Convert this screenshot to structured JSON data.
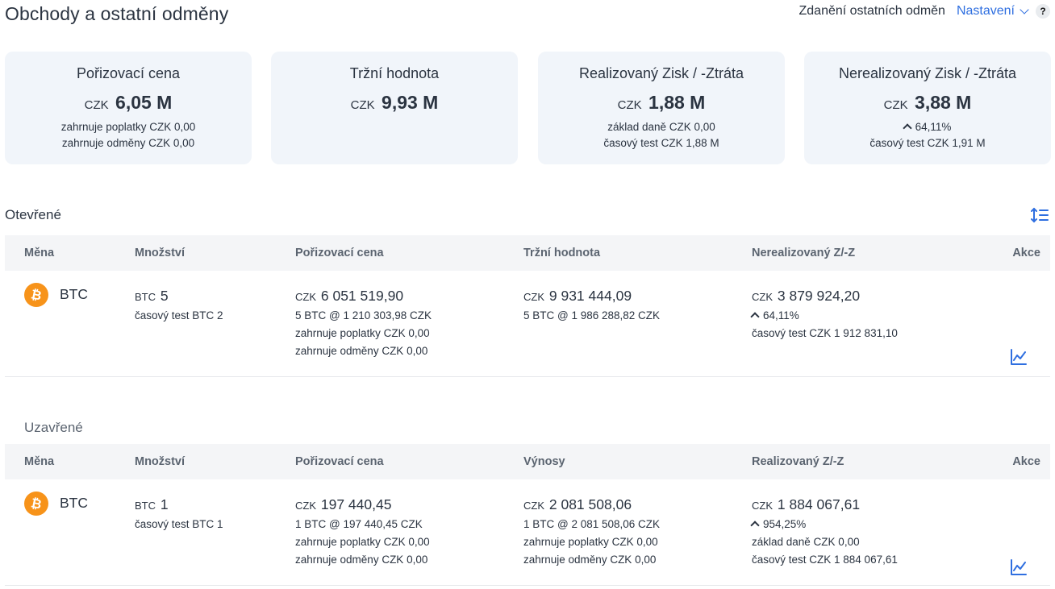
{
  "header": {
    "title": "Obchody a ostatní odměny",
    "tax_label": "Zdanění ostatních odměn",
    "settings_label": "Nastavení",
    "help_label": "?"
  },
  "cards": [
    {
      "title": "Pořizovací cena",
      "currency": "CZK",
      "value": "6,05 M",
      "lines": [
        "zahrnuje poplatky CZK 0,00",
        "zahrnuje odměny CZK 0,00"
      ]
    },
    {
      "title": "Tržní hodnota",
      "currency": "CZK",
      "value": "9,93 M",
      "lines": []
    },
    {
      "title": "Realizovaný Zisk / -Ztráta",
      "currency": "CZK",
      "value": "1,88 M",
      "lines": [
        "základ daně CZK 0,00",
        "časový test CZK 1,88 M"
      ]
    },
    {
      "title": "Nerealizovaný Zisk / -Ztráta",
      "currency": "CZK",
      "value": "3,88 M",
      "change": "64,11%",
      "lines": [
        "časový test CZK 1,91 M"
      ]
    }
  ],
  "open": {
    "title": "Otevřené",
    "columns": [
      "Měna",
      "Množství",
      "Pořizovací cena",
      "Tržní hodnota",
      "Nerealizovaný Z/-Z",
      "Akce"
    ],
    "rows": [
      {
        "coin": "BTC",
        "qty_cur": "BTC",
        "qty": "5",
        "qty_sub": "časový test BTC 2",
        "cost_cur": "CZK",
        "cost": "6 051 519,90",
        "cost_sub": [
          "5 BTC @ 1 210 303,98 CZK",
          "zahrnuje poplatky CZK 0,00",
          "zahrnuje odměny CZK 0,00"
        ],
        "mv_cur": "CZK",
        "mv": "9 931 444,09",
        "mv_sub": [
          "5 BTC @ 1 986 288,82 CZK"
        ],
        "pl_cur": "CZK",
        "pl": "3 879 924,20",
        "pl_change": "64,11%",
        "pl_sub": [
          "časový test CZK 1 912 831,10"
        ]
      }
    ]
  },
  "closed": {
    "title": "Uzavřené",
    "columns": [
      "Měna",
      "Množství",
      "Pořizovací cena",
      "Výnosy",
      "Realizovaný Z/-Z",
      "Akce"
    ],
    "rows": [
      {
        "coin": "BTC",
        "qty_cur": "BTC",
        "qty": "1",
        "qty_sub": "časový test BTC 1",
        "cost_cur": "CZK",
        "cost": "197 440,45",
        "cost_sub": [
          "1 BTC @ 197 440,45 CZK",
          "zahrnuje poplatky CZK 0,00",
          "zahrnuje odměny CZK 0,00"
        ],
        "mv_cur": "CZK",
        "mv": "2 081 508,06",
        "mv_sub": [
          "1 BTC @ 2 081 508,06 CZK",
          "zahrnuje poplatky CZK 0,00",
          "zahrnuje odměny CZK 0,00"
        ],
        "pl_cur": "CZK",
        "pl": "1 884 067,61",
        "pl_change": "954,25%",
        "pl_sub": [
          "základ daně CZK 0,00",
          "časový test CZK 1 884 067,61"
        ]
      }
    ]
  },
  "colors": {
    "accent": "#2f6fe0",
    "card_bg": "#f1f5fa",
    "btc": "#f7931a"
  },
  "icons": [
    "chevron-down-icon",
    "help-icon",
    "arrow-up-icon",
    "sort-icon",
    "bitcoin-icon",
    "chart-line-icon"
  ]
}
